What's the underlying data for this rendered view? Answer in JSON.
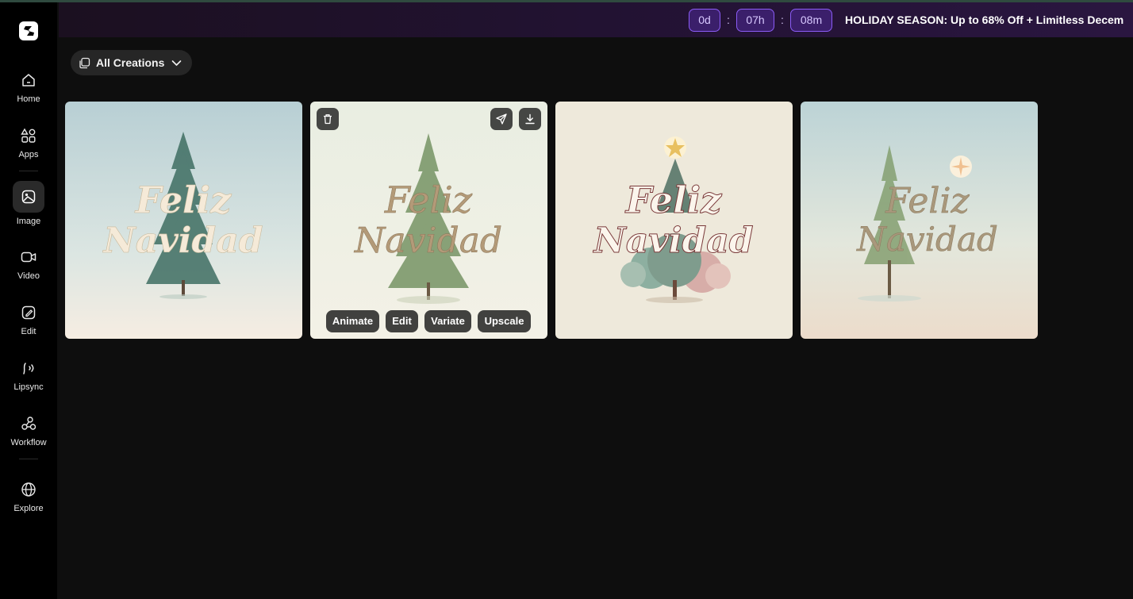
{
  "sidebar": {
    "items": [
      {
        "label": "Home",
        "icon": "home-icon"
      },
      {
        "label": "Apps",
        "icon": "apps-icon"
      },
      {
        "label": "Image",
        "icon": "image-icon",
        "active": true
      },
      {
        "label": "Video",
        "icon": "video-icon"
      },
      {
        "label": "Edit",
        "icon": "edit-icon"
      },
      {
        "label": "Lipsync",
        "icon": "lipsync-icon"
      },
      {
        "label": "Workflow",
        "icon": "workflow-icon"
      },
      {
        "label": "Explore",
        "icon": "globe-icon"
      }
    ]
  },
  "banner": {
    "days": "0d",
    "hours": "07h",
    "minutes": "08m",
    "separator": ":",
    "text": "HOLIDAY SEASON: Up to 68% Off + Limitless Decem"
  },
  "filter": {
    "label": "All Creations"
  },
  "gallery": {
    "cards": [
      {
        "line1": "Feliz",
        "line2": "Navidad"
      },
      {
        "line1": "Feliz",
        "line2": "Navidad",
        "hovered": true
      },
      {
        "line1": "Feliz",
        "line2": "Navidad"
      },
      {
        "line1": "Feliz",
        "line2": "Navidad"
      }
    ],
    "actions": {
      "animate": "Animate",
      "edit": "Edit",
      "variate": "Variate",
      "upscale": "Upscale"
    }
  },
  "colors": {
    "accent": "#8b5cf6",
    "background": "#0e0e0e",
    "sidebar": "#000000"
  }
}
